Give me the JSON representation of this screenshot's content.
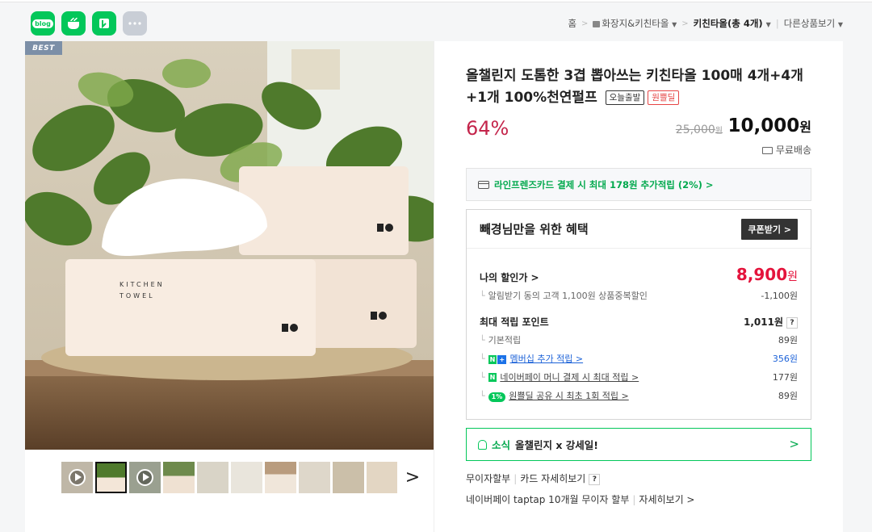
{
  "share": {
    "blog": "blog",
    "icons": [
      "blog-icon",
      "talk-icon",
      "bookmark-icon",
      "more-icon"
    ]
  },
  "breadcrumb": {
    "home": "홈",
    "category": "화장지&키친타올",
    "current": "키친타올(총 4개)",
    "other": "다른상품보기"
  },
  "product": {
    "badge": "BEST",
    "title": "올챌린지 도톰한 3겹 뽑아쓰는 키친타올 100매 4개+4개+1개 100%천연펄프",
    "tag_today": "오늘출발",
    "tag_onepl": "원쁠딜",
    "discount": "64%",
    "orig_price": "25,000",
    "orig_unit": "원",
    "price": "10,000",
    "price_unit": "원",
    "shipping": "무료배송",
    "package_text": "KITCHEN TOWEL"
  },
  "cardpay": {
    "text": "라인프렌즈카드 결제 시 최대 178원 추가적립 (2%) >"
  },
  "benefit": {
    "title": "빼경님만을 위한 혜택",
    "coupon_button": "쿠폰받기 >",
    "my_price_label": "나의 할인가 >",
    "my_price": "8,900",
    "my_price_unit": "원",
    "alarm_label": "알림받기 동의 고객 1,100원 상품중복할인",
    "alarm_value": "-1,100원",
    "max_point_label": "최대 적립 포인트",
    "max_point_value": "1,011원",
    "help": "?",
    "basic_label": "기본적립",
    "basic_value": "89원",
    "membership_label": "멤버십 추가 적립 >",
    "membership_value": "356원",
    "npay_label": "네이버페이 머니 결제 시 최대 적립 >",
    "npay_value": "177원",
    "share_label": "원쁠딜 공유 시 최초 1회 적립 >",
    "share_value": "89원",
    "share_pct": "1%",
    "n_badge": "N",
    "plus_badge": "+",
    "pay_badge": "N"
  },
  "news": {
    "label": "소식",
    "text": "올챌린지 x 강세일!",
    "arrow": ">"
  },
  "footer": {
    "installment": "무이자할부",
    "card_detail": "카드 자세히보기",
    "help": "?",
    "taptap": "네이버페이 taptap 10개월 무이자 할부",
    "detail": "자세히보기 >"
  },
  "thumbs": {
    "next": ">"
  }
}
